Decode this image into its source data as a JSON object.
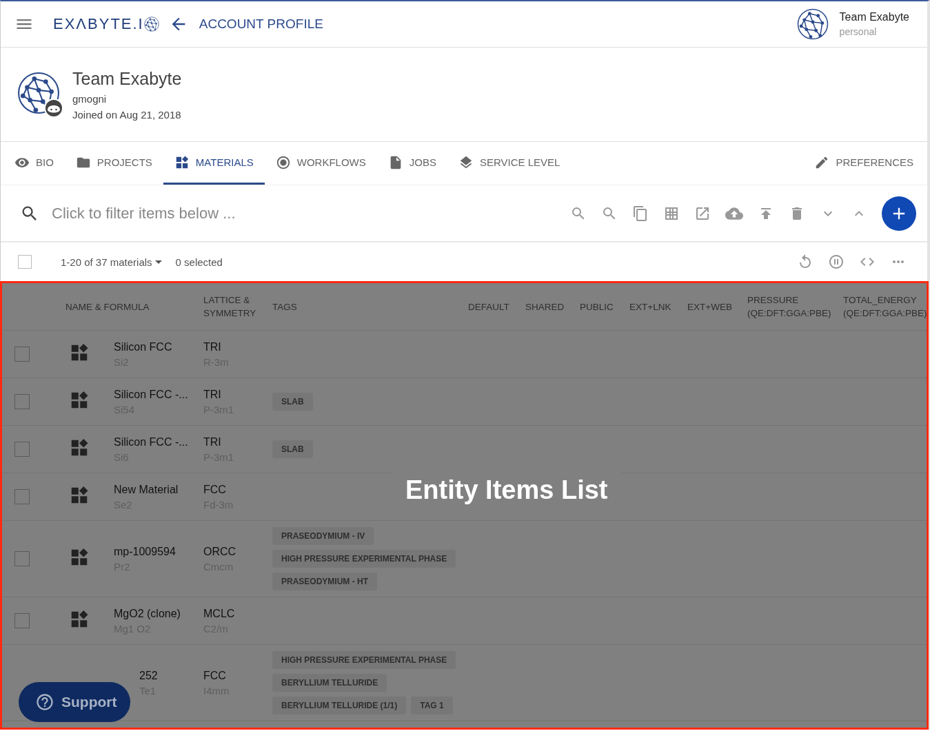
{
  "top_bar": {
    "logo": "EXΛBYTE.I",
    "title": "ACCOUNT PROFILE",
    "user": {
      "name": "Team Exabyte",
      "account_type": "personal"
    }
  },
  "profile": {
    "name": "Team Exabyte",
    "username": "gmogni",
    "joined": "Joined on Aug 21, 2018"
  },
  "tabs": [
    {
      "label": "BIO",
      "selected": false
    },
    {
      "label": "PROJECTS",
      "selected": false
    },
    {
      "label": "MATERIALS",
      "selected": true
    },
    {
      "label": "WORKFLOWS",
      "selected": false
    },
    {
      "label": "JOBS",
      "selected": false
    },
    {
      "label": "SERVICE LEVEL",
      "selected": false
    }
  ],
  "preferences_tab": {
    "label": "PREFERENCES",
    "selected": false
  },
  "filter": {
    "placeholder": "Click to filter items below ..."
  },
  "list_bar": {
    "checked": false,
    "count": "1-20 of 37 materials",
    "selected_count": "0 selected"
  },
  "table": {
    "columns": [
      "NAME & FORMULA",
      "LATTICE & SYMMETRY",
      "TAGS",
      "DEFAULT",
      "SHARED",
      "PUBLIC",
      "EXT+LNK",
      "EXT+WEB",
      "PRESSURE (QE:DFT:GGA:PBE)",
      "TOTAL_ENERGY (QE:DFT:GGA:PBE)"
    ],
    "rows": [
      {
        "checked": false,
        "name": "Silicon FCC",
        "formula": "Si2",
        "lattice": "TRI",
        "symmetry": "R-3m",
        "tags": []
      },
      {
        "checked": false,
        "name": "Silicon FCC -...",
        "formula": "Si54",
        "lattice": "TRI",
        "symmetry": "P-3m1",
        "tags": [
          "SLAB"
        ]
      },
      {
        "checked": false,
        "name": "Silicon FCC -...",
        "formula": "Si6",
        "lattice": "TRI",
        "symmetry": "P-3m1",
        "tags": [
          "SLAB"
        ]
      },
      {
        "checked": false,
        "name": "New Material",
        "formula": "Se2",
        "lattice": "FCC",
        "symmetry": "Fd-3m",
        "tags": []
      },
      {
        "checked": false,
        "name": "mp-1009594",
        "formula": "Pr2",
        "lattice": "ORCC",
        "symmetry": "Cmcm",
        "tags": [
          "PRASEODYMIUM - IV",
          "HIGH PRESSURE EXPERIMENTAL PHASE",
          "PRASEODYMIUM - HT"
        ]
      },
      {
        "checked": false,
        "name": "MgO2 (clone)",
        "formula": "Mg1 O2",
        "lattice": "MCLC",
        "symmetry": "C2/m",
        "tags": []
      },
      {
        "covered": true,
        "name": "252",
        "formula": "Te1",
        "lattice": "FCC",
        "symmetry": "I4mm",
        "tags": [
          "HIGH PRESSURE EXPERIMENTAL PHASE",
          "BERYLLIUM TELLURIDE",
          "BERYLLIUM TELLURIDE (1/1)",
          "TAG 1"
        ]
      }
    ]
  },
  "annotation": {
    "label": "Entity Items List"
  },
  "support_button": {
    "label": "Support"
  }
}
